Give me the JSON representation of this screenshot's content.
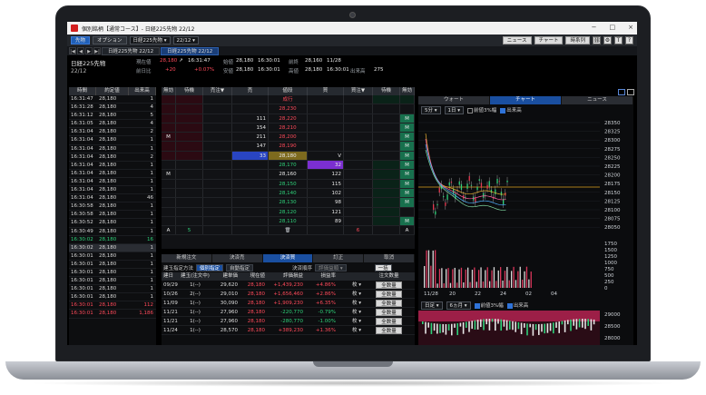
{
  "window": {
    "title": "個別銘柄【通常コース】- 日経225先物 22/12",
    "controls": [
      "−",
      "□",
      "×"
    ]
  },
  "toolbar": {
    "futures_btn": "先物",
    "option_btn": "オプション",
    "symbol_select": "日経225先物",
    "contract_select": "22/12",
    "news_btn": "ニュース",
    "chart_btn": "チャート",
    "timeseries_btn": "時系列",
    "help": "?"
  },
  "tabs": [
    "日経225先物 22/12",
    "日経225先物 22/12"
  ],
  "quote": {
    "name": "日経225先物",
    "contract": "22/12",
    "labels": {
      "current": "現在値",
      "prev": "前日比",
      "open": "始値",
      "low": "安値",
      "prev_close": "前終",
      "high": "高値",
      "volume": "出来高"
    },
    "current": "28,180",
    "current_arrow": "↗",
    "current_time": "16:31:47",
    "change": "+20",
    "change_pct": "+0.07%",
    "open": "28,180",
    "open_time": "16:30:01",
    "low": "28,180",
    "low_time": "16:30:01",
    "prev_close": "28,160",
    "prev_close_date": "11/28",
    "high": "28,180",
    "high_time": "16:30:01",
    "volume": "275"
  },
  "ts": {
    "headers": [
      "時間",
      "約定値",
      "出来高"
    ],
    "rows": [
      {
        "t": "16:31:47",
        "p": "28,180",
        "v": "1",
        "c": ""
      },
      {
        "t": "16:31:28",
        "p": "28,180",
        "v": "4",
        "c": ""
      },
      {
        "t": "16:31:12",
        "p": "28,180",
        "v": "5",
        "c": ""
      },
      {
        "t": "16:31:05",
        "p": "28,180",
        "v": "4",
        "c": ""
      },
      {
        "t": "16:31:04",
        "p": "28,180",
        "v": "2",
        "c": ""
      },
      {
        "t": "16:31:04",
        "p": "28,180",
        "v": "1",
        "c": ""
      },
      {
        "t": "16:31:04",
        "p": "28,180",
        "v": "1",
        "c": ""
      },
      {
        "t": "16:31:04",
        "p": "28,180",
        "v": "2",
        "c": ""
      },
      {
        "t": "16:31:04",
        "p": "28,180",
        "v": "1",
        "c": ""
      },
      {
        "t": "16:31:04",
        "p": "28,180",
        "v": "1",
        "c": ""
      },
      {
        "t": "16:31:04",
        "p": "28,180",
        "v": "1",
        "c": ""
      },
      {
        "t": "16:31:04",
        "p": "28,180",
        "v": "1",
        "c": ""
      },
      {
        "t": "16:31:04",
        "p": "28,180",
        "v": "46",
        "c": ""
      },
      {
        "t": "16:30:58",
        "p": "28,180",
        "v": "1",
        "c": ""
      },
      {
        "t": "16:30:58",
        "p": "28,180",
        "v": "1",
        "c": ""
      },
      {
        "t": "16:30:52",
        "p": "28,180",
        "v": "1",
        "c": ""
      },
      {
        "t": "16:30:49",
        "p": "28,180",
        "v": "1",
        "c": ""
      },
      {
        "t": "16:30:02",
        "p": "28,180",
        "v": "16",
        "c": "g"
      },
      {
        "t": "16:30:02",
        "p": "28,180",
        "v": "1",
        "c": "hl"
      },
      {
        "t": "16:30:01",
        "p": "28,180",
        "v": "1",
        "c": ""
      },
      {
        "t": "16:30:01",
        "p": "28,180",
        "v": "1",
        "c": ""
      },
      {
        "t": "16:30:01",
        "p": "28,180",
        "v": "1",
        "c": ""
      },
      {
        "t": "16:30:01",
        "p": "28,180",
        "v": "1",
        "c": ""
      },
      {
        "t": "16:30:01",
        "p": "28,180",
        "v": "1",
        "c": ""
      },
      {
        "t": "16:30:01",
        "p": "28,180",
        "v": "1",
        "c": ""
      },
      {
        "t": "16:30:01",
        "p": "28,180",
        "v": "112",
        "c": "r"
      },
      {
        "t": "16:30:01",
        "p": "28,180",
        "v": "1,186",
        "c": "r"
      }
    ]
  },
  "book": {
    "headers": [
      "無効",
      "待機",
      "売注▼",
      "売",
      "値段",
      "買",
      "買注▼",
      "待機",
      "無効"
    ],
    "market_label": "成行",
    "rows": [
      {
        "ask": "",
        "price": "28,230",
        "bid": "",
        "pc": "red",
        "mark_l": "",
        "mark_r": ""
      },
      {
        "ask": "111",
        "price": "28,220",
        "bid": "",
        "pc": "red",
        "mark_l": "",
        "mark_r": "M"
      },
      {
        "ask": "154",
        "price": "28,210",
        "bid": "",
        "pc": "red",
        "mark_l": "",
        "mark_r": "M"
      },
      {
        "ask": "211",
        "price": "28,200",
        "bid": "",
        "pc": "red",
        "mark_l": "M",
        "mark_r": "M"
      },
      {
        "ask": "147",
        "price": "28,190",
        "bid": "",
        "pc": "red",
        "mark_l": "",
        "mark_r": "M"
      },
      {
        "ask": "33",
        "price": "28,180",
        "bid": "V",
        "pc": "white",
        "mark_l": "",
        "mark_r": "M",
        "cur": true
      },
      {
        "ask": "",
        "price": "28,170",
        "bid": "32",
        "pc": "green",
        "mark_l": "",
        "mark_r": "M"
      },
      {
        "ask": "",
        "price": "28,160",
        "bid": "122",
        "pc": "white",
        "mark_l": "M",
        "mark_r": "M"
      },
      {
        "ask": "",
        "price": "28,150",
        "bid": "115",
        "pc": "green",
        "mark_l": "",
        "mark_r": "M"
      },
      {
        "ask": "",
        "price": "28,140",
        "bid": "102",
        "pc": "green",
        "mark_l": "",
        "mark_r": "M"
      },
      {
        "ask": "",
        "price": "28,130",
        "bid": "98",
        "pc": "green",
        "mark_l": "",
        "mark_r": "M"
      },
      {
        "ask": "",
        "price": "28,120",
        "bid": "121",
        "pc": "green",
        "mark_l": "",
        "mark_r": ""
      },
      {
        "ask": "",
        "price": "28,110",
        "bid": "89",
        "pc": "green",
        "mark_l": "",
        "mark_r": "M"
      }
    ],
    "footer_left": "A",
    "footer_left_num": "5",
    "footer_right_num": "6",
    "footer_right": "A"
  },
  "orders": {
    "tabs": [
      "新規注文",
      "決済売",
      "決済買",
      "訂正",
      "取消"
    ],
    "active_tab": 2,
    "method_label": "建玉指定方法",
    "method_individual": "個別指定",
    "method_auto": "自動指定",
    "order_label": "決済順序",
    "order_select": "評価益順",
    "bulk_btn": "一括",
    "headers": [
      "建日",
      "建玉(注文中)",
      "建単価",
      "現在値",
      "評価損益",
      "損益率",
      "注文数量"
    ],
    "rows": [
      {
        "date": "09/29",
        "qty": "1(--)",
        "price": "29,620",
        "cur": "28,180",
        "pl": "+1,439,230",
        "rate": "+4.86%",
        "plc": "red"
      },
      {
        "date": "10/26",
        "qty": "2(--)",
        "price": "29,010",
        "cur": "28,180",
        "pl": "+1,656,460",
        "rate": "+2.86%",
        "plc": "red"
      },
      {
        "date": "11/09",
        "qty": "1(--)",
        "price": "30,090",
        "cur": "28,180",
        "pl": "+1,909,230",
        "rate": "+6.35%",
        "plc": "red"
      },
      {
        "date": "11/21",
        "qty": "1(--)",
        "price": "27,960",
        "cur": "28,180",
        "pl": "-220,770",
        "rate": "-0.79%",
        "plc": "green"
      },
      {
        "date": "11/21",
        "qty": "1(--)",
        "price": "27,960",
        "cur": "28,180",
        "pl": "-280,770",
        "rate": "-1.00%",
        "plc": "green"
      },
      {
        "date": "11/24",
        "qty": "1(--)",
        "price": "28,570",
        "cur": "28,180",
        "pl": "+389,230",
        "rate": "+1.36%",
        "plc": "red"
      }
    ],
    "qty_select": "枚",
    "all_btn": "全数量"
  },
  "chart": {
    "tabs": [
      "ウォート",
      "チャート",
      "ニュース"
    ],
    "active_tab": 1,
    "interval": "5分",
    "span": "1日",
    "opt1": "前値3%幅",
    "opt2": "出来高",
    "interval2": "日足",
    "span2": "6ヵ月",
    "opt3": "前値3%幅",
    "opt4": "出来高",
    "price_ticks": [
      "28350",
      "28325",
      "28300",
      "28275",
      "28250",
      "28225",
      "28200",
      "28175",
      "28150",
      "28125",
      "28100",
      "28075",
      "28050"
    ],
    "vol_ticks": [
      "1750",
      "1500",
      "1250",
      "1000",
      "750",
      "500",
      "250",
      "0"
    ],
    "x_ticks": [
      "11/28",
      "20",
      "22",
      "24",
      "02",
      "04"
    ],
    "lower_ticks": [
      "29000",
      "28500",
      "28000"
    ]
  }
}
